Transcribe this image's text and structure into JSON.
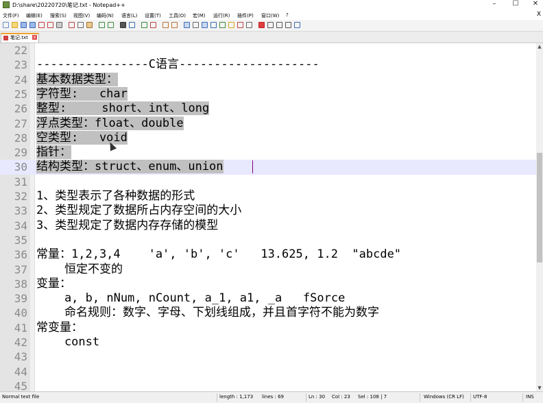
{
  "window": {
    "title": "D:\\share\\20220720\\笔记.txt - Notepad++"
  },
  "menu": [
    "文件(F)",
    "编辑(E)",
    "搜索(S)",
    "视图(V)",
    "编码(N)",
    "语言(L)",
    "设置(T)",
    "工具(O)",
    "宏(M)",
    "运行(R)",
    "插件(P)",
    "窗口(W)",
    "?"
  ],
  "menu_close": "X",
  "tab": {
    "label": "笔记.txt",
    "close": "x"
  },
  "lines": [
    {
      "n": "22",
      "text": ""
    },
    {
      "n": "23",
      "text": "----------------C语言--------------------"
    },
    {
      "n": "24",
      "text": "基本数据类型："
    },
    {
      "n": "25",
      "text": "字符型:   char"
    },
    {
      "n": "26",
      "text": "整型:     short、int、long"
    },
    {
      "n": "27",
      "text": "浮点类型：float、double"
    },
    {
      "n": "28",
      "text": "空类型:   void"
    },
    {
      "n": "29",
      "text": "指针："
    },
    {
      "n": "30",
      "text": "结构类型：struct、enum、union"
    },
    {
      "n": "31",
      "text": ""
    },
    {
      "n": "32",
      "text": "1、类型表示了各种数据的形式"
    },
    {
      "n": "33",
      "text": "2、类型规定了数据所占内存空间的大小"
    },
    {
      "n": "34",
      "text": "3、类型规定了数据内存存储的模型"
    },
    {
      "n": "35",
      "text": ""
    },
    {
      "n": "36",
      "text": "常量：1,2,3,4    'a', 'b', 'c'   13.625, 1.2  \"abcde\""
    },
    {
      "n": "37",
      "text": "    恒定不变的"
    },
    {
      "n": "38",
      "text": "变量："
    },
    {
      "n": "39",
      "text": "    a, b, nNum, nCount, a_1, a1, _a   fSorce"
    },
    {
      "n": "40",
      "text": "    命名规则：数字、字母、下划线组成，并且首字符不能为数字"
    },
    {
      "n": "41",
      "text": "常变量："
    },
    {
      "n": "42",
      "text": "    const"
    },
    {
      "n": "43",
      "text": ""
    },
    {
      "n": "44",
      "text": ""
    },
    {
      "n": "45",
      "text": ""
    }
  ],
  "status": {
    "file_type": "Normal text file",
    "length": "length : 1,173",
    "lines": "lines : 69",
    "ln": "Ln : 30",
    "col": "Col : 23",
    "sel": "Sel : 108 | 7",
    "eol": "Windows (CR LF)",
    "encoding": "UTF-8",
    "mode": "INS"
  },
  "colors": {
    "selection": "#c0c0c0",
    "current_line": "#e8e8ff",
    "gutter": "#e4e4e4",
    "caret": "#800080"
  }
}
